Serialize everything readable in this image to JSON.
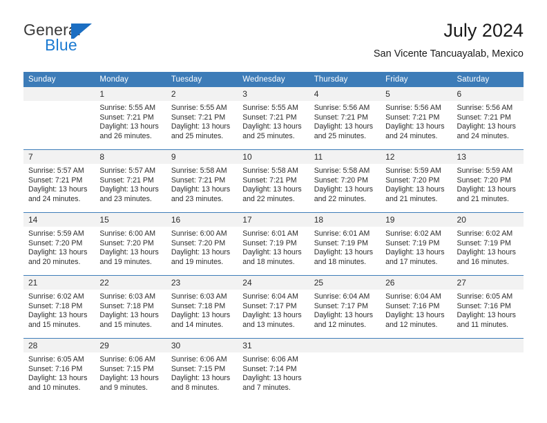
{
  "brand": {
    "name_part1": "General",
    "name_part2": "Blue",
    "flag_icon": "flag-triangle-icon",
    "accent_color": "#1b7ad1"
  },
  "header": {
    "title": "July 2024",
    "location": "San Vicente Tancuayalab, Mexico"
  },
  "theme": {
    "header_row_color": "#3d7cb8",
    "daynum_band_color": "#f2f2f2",
    "text_color": "#2b2b2b"
  },
  "calendar": {
    "weekday_headers": [
      "Sunday",
      "Monday",
      "Tuesday",
      "Wednesday",
      "Thursday",
      "Friday",
      "Saturday"
    ],
    "weeks": [
      [
        {
          "day": "",
          "lines": []
        },
        {
          "day": "1",
          "lines": [
            "Sunrise: 5:55 AM",
            "Sunset: 7:21 PM",
            "Daylight: 13 hours",
            "and 26 minutes."
          ]
        },
        {
          "day": "2",
          "lines": [
            "Sunrise: 5:55 AM",
            "Sunset: 7:21 PM",
            "Daylight: 13 hours",
            "and 25 minutes."
          ]
        },
        {
          "day": "3",
          "lines": [
            "Sunrise: 5:55 AM",
            "Sunset: 7:21 PM",
            "Daylight: 13 hours",
            "and 25 minutes."
          ]
        },
        {
          "day": "4",
          "lines": [
            "Sunrise: 5:56 AM",
            "Sunset: 7:21 PM",
            "Daylight: 13 hours",
            "and 25 minutes."
          ]
        },
        {
          "day": "5",
          "lines": [
            "Sunrise: 5:56 AM",
            "Sunset: 7:21 PM",
            "Daylight: 13 hours",
            "and 24 minutes."
          ]
        },
        {
          "day": "6",
          "lines": [
            "Sunrise: 5:56 AM",
            "Sunset: 7:21 PM",
            "Daylight: 13 hours",
            "and 24 minutes."
          ]
        }
      ],
      [
        {
          "day": "7",
          "lines": [
            "Sunrise: 5:57 AM",
            "Sunset: 7:21 PM",
            "Daylight: 13 hours",
            "and 24 minutes."
          ]
        },
        {
          "day": "8",
          "lines": [
            "Sunrise: 5:57 AM",
            "Sunset: 7:21 PM",
            "Daylight: 13 hours",
            "and 23 minutes."
          ]
        },
        {
          "day": "9",
          "lines": [
            "Sunrise: 5:58 AM",
            "Sunset: 7:21 PM",
            "Daylight: 13 hours",
            "and 23 minutes."
          ]
        },
        {
          "day": "10",
          "lines": [
            "Sunrise: 5:58 AM",
            "Sunset: 7:21 PM",
            "Daylight: 13 hours",
            "and 22 minutes."
          ]
        },
        {
          "day": "11",
          "lines": [
            "Sunrise: 5:58 AM",
            "Sunset: 7:20 PM",
            "Daylight: 13 hours",
            "and 22 minutes."
          ]
        },
        {
          "day": "12",
          "lines": [
            "Sunrise: 5:59 AM",
            "Sunset: 7:20 PM",
            "Daylight: 13 hours",
            "and 21 minutes."
          ]
        },
        {
          "day": "13",
          "lines": [
            "Sunrise: 5:59 AM",
            "Sunset: 7:20 PM",
            "Daylight: 13 hours",
            "and 21 minutes."
          ]
        }
      ],
      [
        {
          "day": "14",
          "lines": [
            "Sunrise: 5:59 AM",
            "Sunset: 7:20 PM",
            "Daylight: 13 hours",
            "and 20 minutes."
          ]
        },
        {
          "day": "15",
          "lines": [
            "Sunrise: 6:00 AM",
            "Sunset: 7:20 PM",
            "Daylight: 13 hours",
            "and 19 minutes."
          ]
        },
        {
          "day": "16",
          "lines": [
            "Sunrise: 6:00 AM",
            "Sunset: 7:20 PM",
            "Daylight: 13 hours",
            "and 19 minutes."
          ]
        },
        {
          "day": "17",
          "lines": [
            "Sunrise: 6:01 AM",
            "Sunset: 7:19 PM",
            "Daylight: 13 hours",
            "and 18 minutes."
          ]
        },
        {
          "day": "18",
          "lines": [
            "Sunrise: 6:01 AM",
            "Sunset: 7:19 PM",
            "Daylight: 13 hours",
            "and 18 minutes."
          ]
        },
        {
          "day": "19",
          "lines": [
            "Sunrise: 6:02 AM",
            "Sunset: 7:19 PM",
            "Daylight: 13 hours",
            "and 17 minutes."
          ]
        },
        {
          "day": "20",
          "lines": [
            "Sunrise: 6:02 AM",
            "Sunset: 7:19 PM",
            "Daylight: 13 hours",
            "and 16 minutes."
          ]
        }
      ],
      [
        {
          "day": "21",
          "lines": [
            "Sunrise: 6:02 AM",
            "Sunset: 7:18 PM",
            "Daylight: 13 hours",
            "and 15 minutes."
          ]
        },
        {
          "day": "22",
          "lines": [
            "Sunrise: 6:03 AM",
            "Sunset: 7:18 PM",
            "Daylight: 13 hours",
            "and 15 minutes."
          ]
        },
        {
          "day": "23",
          "lines": [
            "Sunrise: 6:03 AM",
            "Sunset: 7:18 PM",
            "Daylight: 13 hours",
            "and 14 minutes."
          ]
        },
        {
          "day": "24",
          "lines": [
            "Sunrise: 6:04 AM",
            "Sunset: 7:17 PM",
            "Daylight: 13 hours",
            "and 13 minutes."
          ]
        },
        {
          "day": "25",
          "lines": [
            "Sunrise: 6:04 AM",
            "Sunset: 7:17 PM",
            "Daylight: 13 hours",
            "and 12 minutes."
          ]
        },
        {
          "day": "26",
          "lines": [
            "Sunrise: 6:04 AM",
            "Sunset: 7:16 PM",
            "Daylight: 13 hours",
            "and 12 minutes."
          ]
        },
        {
          "day": "27",
          "lines": [
            "Sunrise: 6:05 AM",
            "Sunset: 7:16 PM",
            "Daylight: 13 hours",
            "and 11 minutes."
          ]
        }
      ],
      [
        {
          "day": "28",
          "lines": [
            "Sunrise: 6:05 AM",
            "Sunset: 7:16 PM",
            "Daylight: 13 hours",
            "and 10 minutes."
          ]
        },
        {
          "day": "29",
          "lines": [
            "Sunrise: 6:06 AM",
            "Sunset: 7:15 PM",
            "Daylight: 13 hours",
            "and 9 minutes."
          ]
        },
        {
          "day": "30",
          "lines": [
            "Sunrise: 6:06 AM",
            "Sunset: 7:15 PM",
            "Daylight: 13 hours",
            "and 8 minutes."
          ]
        },
        {
          "day": "31",
          "lines": [
            "Sunrise: 6:06 AM",
            "Sunset: 7:14 PM",
            "Daylight: 13 hours",
            "and 7 minutes."
          ]
        },
        {
          "day": "",
          "lines": []
        },
        {
          "day": "",
          "lines": []
        },
        {
          "day": "",
          "lines": []
        }
      ]
    ]
  }
}
